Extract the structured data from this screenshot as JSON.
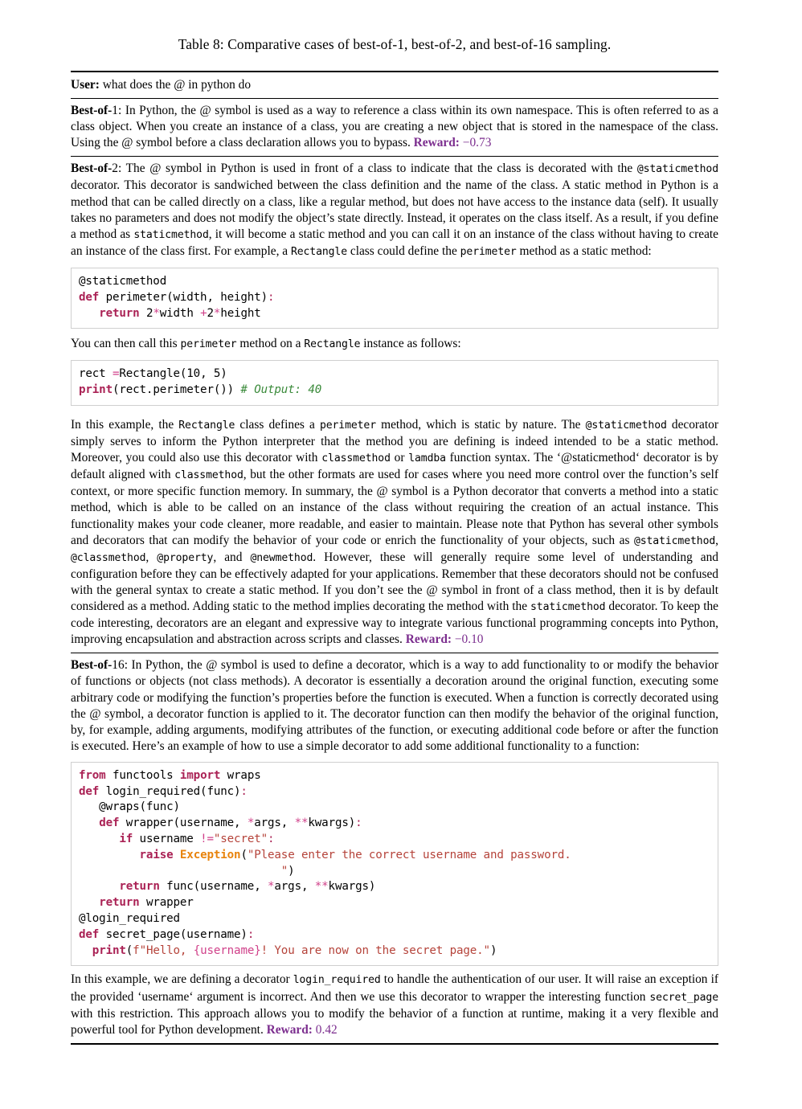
{
  "caption": {
    "label": "Table 8:",
    "text": "Comparative cases of best-of-1, best-of-2, and best-of-16 sampling."
  },
  "table": {
    "user_row": {
      "label": "User:",
      "text": "what does the @ in python do"
    },
    "best_of_1": {
      "label_bold": "Best-of-",
      "label_num": "1",
      "colon": ": ",
      "text": "In Python, the @ symbol is used as a way to reference a class within its own namespace. This is often referred to as a class object. When you create an instance of a class, you are creating a new object that is stored in the namespace of the class. Using the @ symbol before a class declaration allows you to bypass. ",
      "reward_label": "Reward:",
      "reward_value": "−0.73"
    },
    "best_of_2": {
      "label_bold": "Best-of-",
      "label_num": "2",
      "colon": ": ",
      "para1_a": "The @ symbol in Python is used in front of a class to indicate that the class is decorated with the ",
      "para1_code1": "@staticmethod",
      "para1_b": " decorator. This decorator is sandwiched between the class definition and the name of the class. A static method in Python is a method that can be called directly on a class, like a regular method, but does not have access to the instance data (self). It usually takes no parameters and does not modify the object’s state directly. Instead, it operates on the class itself. As a result, if you define a method as ",
      "para1_code2": "staticmethod",
      "para1_c": ", it will become a static method and you can call it on an instance of the class without having to create an instance of the class first. For example, a ",
      "para1_code3": "Rectangle",
      "para1_d": " class could define the ",
      "para1_code4": "perimeter",
      "para1_e": " method as a static method:",
      "code1": [
        {
          "t": "plain",
          "v": "@staticmethod\n"
        },
        {
          "t": "k",
          "v": "def"
        },
        {
          "t": "plain",
          "v": " perimeter(width, height)"
        },
        {
          "t": "pu",
          "v": ":"
        },
        {
          "t": "plain",
          "v": "\n   "
        },
        {
          "t": "k",
          "v": "return"
        },
        {
          "t": "plain",
          "v": " 2"
        },
        {
          "t": "op",
          "v": "*"
        },
        {
          "t": "plain",
          "v": "width "
        },
        {
          "t": "op",
          "v": "+"
        },
        {
          "t": "plain",
          "v": "2"
        },
        {
          "t": "op",
          "v": "*"
        },
        {
          "t": "plain",
          "v": "height"
        }
      ],
      "between_a": "You can then call this ",
      "between_code1": "perimeter",
      "between_b": " method on a ",
      "between_code2": "Rectangle",
      "between_c": " instance as follows:",
      "code2": [
        {
          "t": "plain",
          "v": "rect "
        },
        {
          "t": "op",
          "v": "="
        },
        {
          "t": "plain",
          "v": "Rectangle(10, 5)\n"
        },
        {
          "t": "k",
          "v": "print"
        },
        {
          "t": "plain",
          "v": "(rect.perimeter()) "
        },
        {
          "t": "co",
          "v": "# Output: 40"
        }
      ],
      "para2_a": "In this example, the ",
      "para2_code1": "Rectangle",
      "para2_b": " class defines a ",
      "para2_code2": "perimeter",
      "para2_c": " method, which is static by nature.  The ",
      "para2_code3": "@staticmethod",
      "para2_d": " decorator simply serves to inform the Python interpreter that the method you are defining is indeed intended to be a static method. Moreover, you could also use this decorator with ",
      "para2_code4": "classmethod",
      "para2_e": " or ",
      "para2_code5": "lamdba",
      "para2_f": " function syntax. The ‘@staticmethod‘ decorator is by default aligned with ",
      "para2_code6": "classmethod",
      "para2_g": ", but the other formats are used for cases where you need more control over the function’s self context, or more specific function memory. In summary, the @ symbol is a Python decorator that converts a method into a static method, which is able to be called on an instance of the class without requiring the creation of an actual instance. This functionality makes your code cleaner, more readable, and easier to maintain. Please note that Python has several other symbols and decorators that can modify the behavior of your code or enrich the functionality of your objects, such as ",
      "para2_code7": "@staticmethod",
      "para2_h": ", ",
      "para2_code8": "@classmethod",
      "para2_i": ", ",
      "para2_code9": "@property",
      "para2_j": ", and ",
      "para2_code10": "@newmethod",
      "para2_k": ". However, these will generally require some level of understanding and configuration before they can be effectively adapted for your applications. Remember that these decorators should not be confused with the general syntax to create a static method. If you don’t see the @ symbol in front of a class method, then it is by default considered as a method. Adding static to the method implies decorating the method with the ",
      "para2_code11": "staticmethod",
      "para2_l": " decorator. To keep the code interesting, decorators are an elegant and expressive way to integrate various functional programming concepts into Python, improving encapsulation and abstraction across scripts and classes. ",
      "reward_label": "Reward:",
      "reward_value": "−0.10"
    },
    "best_of_16": {
      "label_bold": "Best-of-",
      "label_num": "16",
      "colon": ": ",
      "para1": "In Python, the @ symbol is used to define a decorator, which is a way to add functionality to or modify the behavior of functions or objects (not class methods). A decorator is essentially a decoration around the original function, executing some arbitrary code or modifying the function’s properties before the function is executed. When a function is correctly decorated using the @ symbol, a decorator function is applied to it. The decorator function can then modify the behavior of the original function, by, for example, adding arguments, modifying attributes of the function, or executing additional code before or after the function is executed. Here’s an example of how to use a simple decorator to add some additional functionality to a function:",
      "code3": [
        {
          "t": "k",
          "v": "from"
        },
        {
          "t": "plain",
          "v": " functools "
        },
        {
          "t": "k",
          "v": "import"
        },
        {
          "t": "plain",
          "v": " wraps\n"
        },
        {
          "t": "k",
          "v": "def"
        },
        {
          "t": "plain",
          "v": " login_required(func)"
        },
        {
          "t": "pu",
          "v": ":"
        },
        {
          "t": "plain",
          "v": "\n   @wraps(func)\n   "
        },
        {
          "t": "k",
          "v": "def"
        },
        {
          "t": "plain",
          "v": " wrapper(username, "
        },
        {
          "t": "op",
          "v": "*"
        },
        {
          "t": "plain",
          "v": "args, "
        },
        {
          "t": "op",
          "v": "**"
        },
        {
          "t": "plain",
          "v": "kwargs)"
        },
        {
          "t": "pu",
          "v": ":"
        },
        {
          "t": "plain",
          "v": "\n      "
        },
        {
          "t": "k",
          "v": "if"
        },
        {
          "t": "plain",
          "v": " username "
        },
        {
          "t": "op",
          "v": "!="
        },
        {
          "t": "st",
          "v": "\"secret\""
        },
        {
          "t": "pu",
          "v": ":"
        },
        {
          "t": "plain",
          "v": "\n         "
        },
        {
          "t": "k",
          "v": "raise"
        },
        {
          "t": "plain",
          "v": " "
        },
        {
          "t": "ex",
          "v": "Exception"
        },
        {
          "t": "plain",
          "v": "("
        },
        {
          "t": "st",
          "v": "\"Please enter the correct username and password.\n                              \""
        },
        {
          "t": "plain",
          "v": ")\n      "
        },
        {
          "t": "k",
          "v": "return"
        },
        {
          "t": "plain",
          "v": " func(username, "
        },
        {
          "t": "op",
          "v": "*"
        },
        {
          "t": "plain",
          "v": "args, "
        },
        {
          "t": "op",
          "v": "**"
        },
        {
          "t": "plain",
          "v": "kwargs)\n   "
        },
        {
          "t": "k",
          "v": "return"
        },
        {
          "t": "plain",
          "v": " wrapper\n@login_required\n"
        },
        {
          "t": "k",
          "v": "def"
        },
        {
          "t": "plain",
          "v": " secret_page(username)"
        },
        {
          "t": "pu",
          "v": ":"
        },
        {
          "t": "plain",
          "v": "\n  "
        },
        {
          "t": "k",
          "v": "print"
        },
        {
          "t": "plain",
          "v": "("
        },
        {
          "t": "st",
          "v": "f\"Hello, "
        },
        {
          "t": "fs",
          "v": "{username}"
        },
        {
          "t": "st",
          "v": "! You are now on the secret page.\""
        },
        {
          "t": "plain",
          "v": ")"
        }
      ],
      "para2_a": "In this example, we are defining a decorator ",
      "para2_code1": "login_required",
      "para2_b": " to handle the authentication of our user. It will raise an exception if the provided ‘username‘ argument is incorrect. And then we use this decorator to wrapper the interesting function ",
      "para2_code2": "secret_page",
      "para2_c": " with this restriction. This approach allows you to modify the behavior of a function at runtime, making it a very flexible and powerful tool for Python development. ",
      "reward_label": "Reward:",
      "reward_value": "0.42"
    }
  },
  "colors": {
    "reward": "#7b2d8e",
    "keyword": "#aa2255",
    "operator": "#d0418a",
    "comment": "#3a8a3a",
    "string": "#b5433a",
    "exception": "#e8830c",
    "rule": "#000000",
    "code_border": "#cfcfcf"
  }
}
